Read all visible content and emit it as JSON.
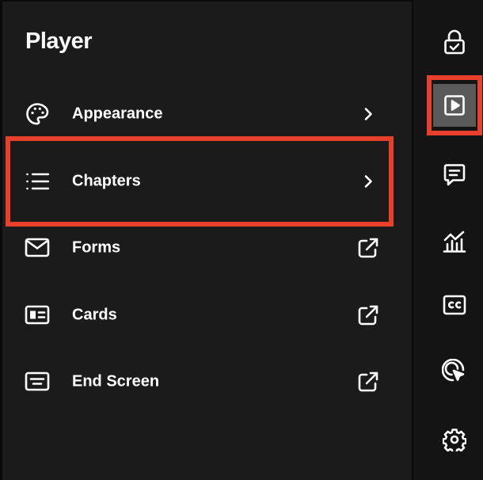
{
  "panel": {
    "title": "Player",
    "items": [
      {
        "label": "Appearance",
        "icon": "palette-icon",
        "trailing": "chevron-right-icon"
      },
      {
        "label": "Chapters",
        "icon": "list-icon",
        "trailing": "chevron-right-icon"
      },
      {
        "label": "Forms",
        "icon": "envelope-icon",
        "trailing": "external-link-icon"
      },
      {
        "label": "Cards",
        "icon": "id-card-icon",
        "trailing": "external-link-icon"
      },
      {
        "label": "End Screen",
        "icon": "end-screen-icon",
        "trailing": "external-link-icon"
      }
    ]
  },
  "rail": {
    "items": [
      {
        "icon": "lock-check-icon",
        "active": false
      },
      {
        "icon": "play-icon",
        "active": true
      },
      {
        "icon": "comment-icon",
        "active": false
      },
      {
        "icon": "analytics-icon",
        "active": false
      },
      {
        "icon": "closed-captions-icon",
        "active": false
      },
      {
        "icon": "click-target-icon",
        "active": false
      },
      {
        "icon": "gear-icon",
        "active": false
      }
    ]
  },
  "colors": {
    "background": "#1b1b1b",
    "rail_background": "#141414",
    "active_rail": "#5a5a5a",
    "highlight": "#e8402b",
    "text": "#ffffff"
  }
}
